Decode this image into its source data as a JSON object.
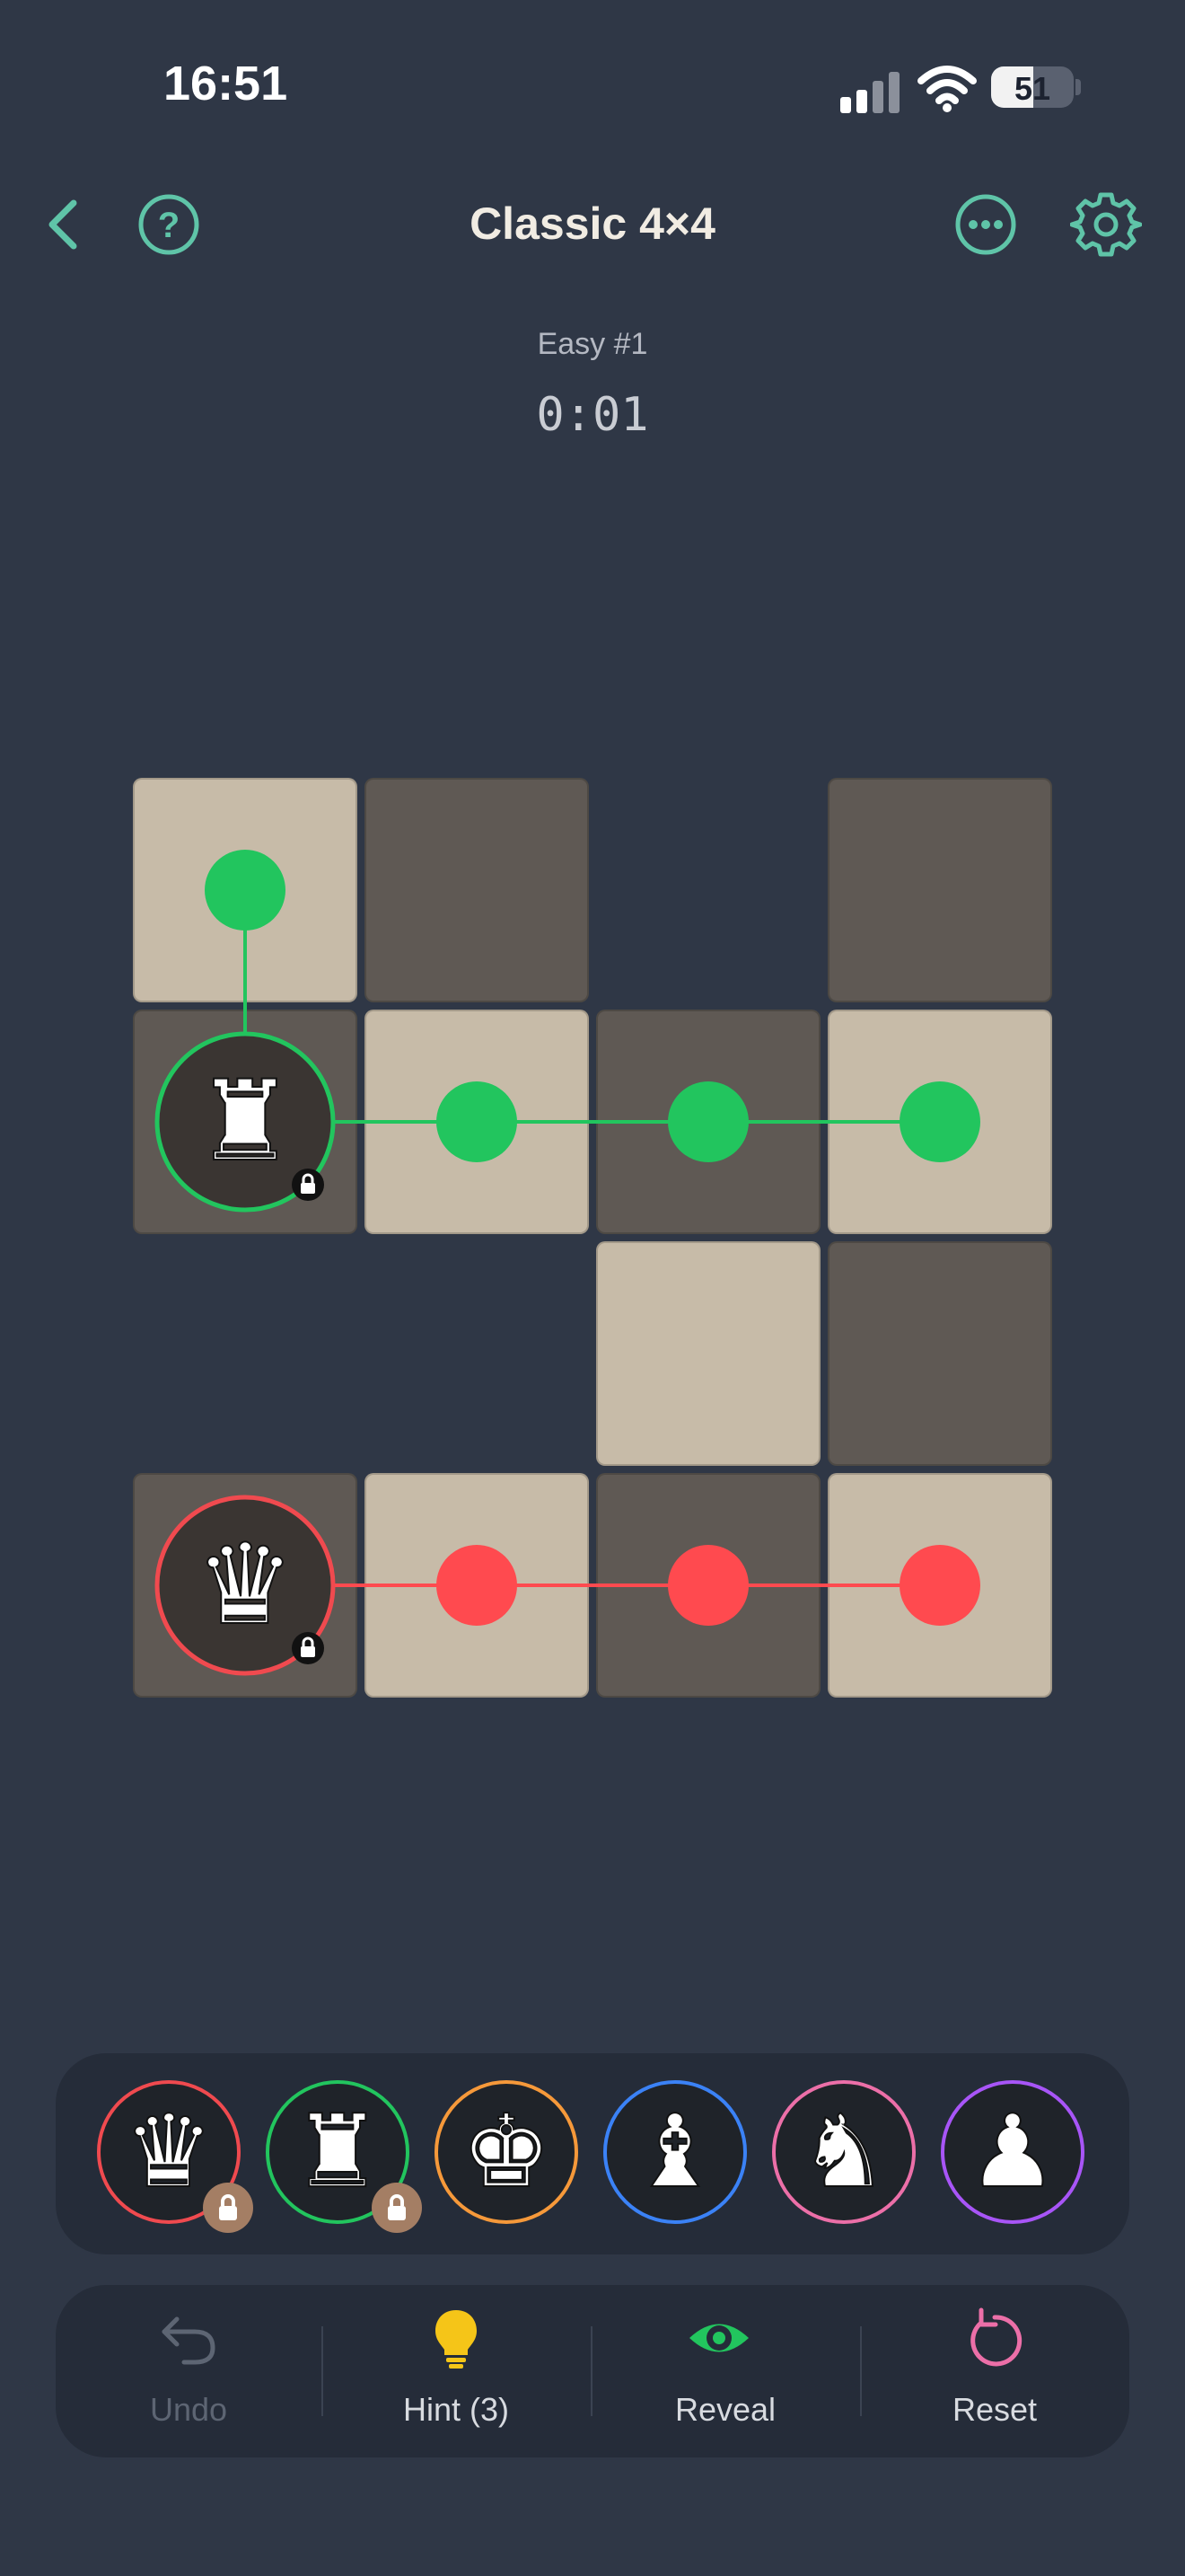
{
  "status_bar": {
    "time": "16:51",
    "battery": "51"
  },
  "header": {
    "title": "Classic 4×4",
    "back_icon": "chevron-left-icon",
    "help_icon": "question-circle-icon",
    "more_icon": "ellipsis-circle-icon",
    "settings_icon": "gear-icon",
    "accent_color": "#5fc4a8"
  },
  "puzzle": {
    "level": "Easy #1",
    "timer": "0:01"
  },
  "board": {
    "rows": 4,
    "cols": 4,
    "cells": [
      {
        "row": 0,
        "col": 0,
        "shade": "light"
      },
      {
        "row": 0,
        "col": 1,
        "shade": "dark"
      },
      {
        "row": 0,
        "col": 3,
        "shade": "dark"
      },
      {
        "row": 1,
        "col": 0,
        "shade": "dark"
      },
      {
        "row": 1,
        "col": 1,
        "shade": "light"
      },
      {
        "row": 1,
        "col": 2,
        "shade": "dark"
      },
      {
        "row": 1,
        "col": 3,
        "shade": "light"
      },
      {
        "row": 2,
        "col": 2,
        "shade": "light"
      },
      {
        "row": 2,
        "col": 3,
        "shade": "dark"
      },
      {
        "row": 3,
        "col": 0,
        "shade": "dark"
      },
      {
        "row": 3,
        "col": 1,
        "shade": "light"
      },
      {
        "row": 3,
        "col": 2,
        "shade": "dark"
      },
      {
        "row": 3,
        "col": 3,
        "shade": "light"
      }
    ],
    "placed_pieces": [
      {
        "piece": "rook",
        "glyph": "♜",
        "row": 1,
        "col": 0,
        "color": "#22c55e",
        "locked": true
      },
      {
        "piece": "queen",
        "glyph": "♛",
        "row": 3,
        "col": 0,
        "color": "#f04a4f",
        "locked": true
      }
    ],
    "move_dots": [
      {
        "row": 0,
        "col": 0,
        "color": "#22c55e"
      },
      {
        "row": 1,
        "col": 1,
        "color": "#22c55e"
      },
      {
        "row": 1,
        "col": 2,
        "color": "#22c55e"
      },
      {
        "row": 1,
        "col": 3,
        "color": "#22c55e"
      },
      {
        "row": 3,
        "col": 1,
        "color": "#ff4a4f"
      },
      {
        "row": 3,
        "col": 2,
        "color": "#ff4a4f"
      },
      {
        "row": 3,
        "col": 3,
        "color": "#ff4a4f"
      }
    ]
  },
  "tray": {
    "pieces": [
      {
        "piece": "queen",
        "glyph": "♛",
        "color": "#f04a4f",
        "locked": true
      },
      {
        "piece": "rook",
        "glyph": "♜",
        "color": "#22c55e",
        "locked": true
      },
      {
        "piece": "king",
        "glyph": "♚",
        "color": "#f6993a",
        "locked": false
      },
      {
        "piece": "bishop",
        "glyph": "♝",
        "color": "#3b82f6",
        "locked": false
      },
      {
        "piece": "knight",
        "glyph": "♞",
        "color": "#ec6fa8",
        "locked": false
      },
      {
        "piece": "pawn",
        "glyph": "♟",
        "color": "#a855f7",
        "locked": false
      }
    ]
  },
  "actions": {
    "undo": {
      "label": "Undo",
      "icon": "undo-arrow-icon",
      "color": "#5d6573"
    },
    "hint": {
      "label": "Hint (3)",
      "icon": "lightbulb-icon",
      "color": "#f5c518"
    },
    "reveal": {
      "label": "Reveal",
      "icon": "eye-icon",
      "color": "#22c55e"
    },
    "reset": {
      "label": "Reset",
      "icon": "reset-arrow-icon",
      "color": "#ec6fa8"
    }
  }
}
